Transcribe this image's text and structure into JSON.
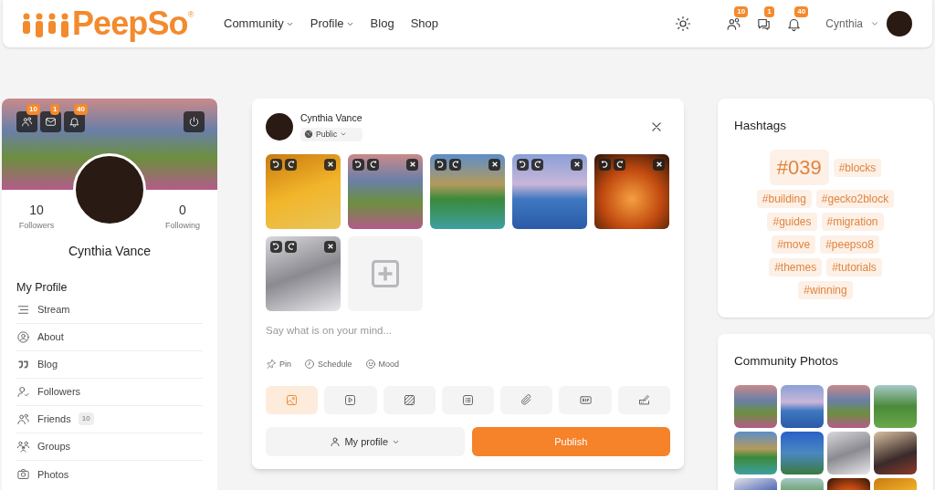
{
  "header": {
    "logo": "PeepSo",
    "logo_mark": "®",
    "nav": [
      {
        "label": "Community",
        "dropdown": true
      },
      {
        "label": "Profile",
        "dropdown": true
      },
      {
        "label": "Blog",
        "dropdown": false
      },
      {
        "label": "Shop",
        "dropdown": false
      }
    ],
    "badges": [
      {
        "kind": "friends",
        "count": "10"
      },
      {
        "kind": "messages",
        "count": "1"
      },
      {
        "kind": "notifications",
        "count": "40"
      }
    ],
    "user": "Cynthia"
  },
  "profile_card": {
    "badges": [
      {
        "kind": "friends",
        "count": "10"
      },
      {
        "kind": "mail",
        "count": "1"
      },
      {
        "kind": "notifications",
        "count": "40"
      }
    ],
    "stats": [
      {
        "count": "10",
        "label": "Followers"
      },
      {
        "count": "0",
        "label": "Following"
      }
    ],
    "name": "Cynthia Vance",
    "menu_title": "My Profile",
    "menu": [
      {
        "kind": "stream",
        "label": "Stream"
      },
      {
        "kind": "about",
        "label": "About"
      },
      {
        "kind": "blog",
        "label": "Blog"
      },
      {
        "kind": "followers",
        "label": "Followers"
      },
      {
        "kind": "friends",
        "label": "Friends",
        "count": "10"
      },
      {
        "kind": "groups",
        "label": "Groups"
      },
      {
        "kind": "photos",
        "label": "Photos"
      }
    ]
  },
  "composer": {
    "author": "Cynthia Vance",
    "privacy": "Public",
    "photos": [
      {
        "kind": "autumn"
      },
      {
        "kind": "meadow"
      },
      {
        "kind": "lake"
      },
      {
        "kind": "tree"
      },
      {
        "kind": "orange-bike"
      },
      {
        "kind": "silver-bike"
      }
    ],
    "placeholder": "Say what is on your mind...",
    "options": [
      {
        "kind": "pin",
        "label": "Pin"
      },
      {
        "kind": "schedule",
        "label": "Schedule"
      },
      {
        "kind": "mood",
        "label": "Mood"
      }
    ],
    "attach_tabs": [
      {
        "kind": "photo",
        "selected": true
      },
      {
        "kind": "video",
        "selected": false
      },
      {
        "kind": "background",
        "selected": false
      },
      {
        "kind": "poll",
        "selected": false
      },
      {
        "kind": "file",
        "selected": false
      },
      {
        "kind": "gif",
        "selected": false
      },
      {
        "kind": "sign",
        "selected": false
      }
    ],
    "audience": "My profile",
    "publish": "Publish"
  },
  "hashtags": {
    "title": "Hashtags",
    "tags": [
      {
        "label": "#039",
        "kind": "large"
      },
      {
        "label": "#blocks",
        "kind": "normal"
      },
      {
        "label": "#building",
        "kind": "normal"
      },
      {
        "label": "#gecko2block",
        "kind": "normal"
      },
      {
        "label": "#guides",
        "kind": "normal"
      },
      {
        "label": "#migration",
        "kind": "normal"
      },
      {
        "label": "#move",
        "kind": "normal"
      },
      {
        "label": "#peepso8",
        "kind": "normal"
      },
      {
        "label": "#themes",
        "kind": "normal"
      },
      {
        "label": "#tutorials",
        "kind": "normal"
      },
      {
        "label": "#winning",
        "kind": "normal"
      }
    ]
  },
  "community_photos": {
    "title": "Community Photos",
    "photos": [
      {
        "kind": "meadow"
      },
      {
        "kind": "tree"
      },
      {
        "kind": "meadow"
      },
      {
        "kind": "valley"
      },
      {
        "kind": "lake"
      },
      {
        "kind": "mountain"
      },
      {
        "kind": "silver-bike"
      },
      {
        "kind": "dark-bike"
      },
      {
        "kind": "blue-bike"
      },
      {
        "kind": "valley"
      },
      {
        "kind": "orange-bike"
      },
      {
        "kind": "autumn"
      }
    ]
  }
}
